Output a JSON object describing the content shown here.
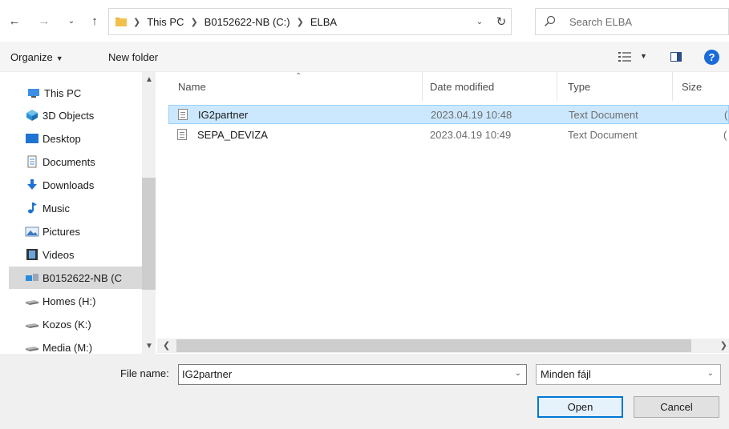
{
  "address": {
    "crumbs": [
      "This PC",
      "B0152622-NB (C:)",
      "ELBA"
    ]
  },
  "search": {
    "placeholder": "Search ELBA"
  },
  "toolbar": {
    "organize_label": "Organize",
    "new_folder_label": "New folder"
  },
  "navpane": {
    "items": [
      {
        "label": "This PC",
        "icon": "computer-icon"
      },
      {
        "label": "3D Objects",
        "icon": "cube-icon"
      },
      {
        "label": "Desktop",
        "icon": "desktop-icon"
      },
      {
        "label": "Documents",
        "icon": "document-icon"
      },
      {
        "label": "Downloads",
        "icon": "download-arrow-icon"
      },
      {
        "label": "Music",
        "icon": "music-note-icon"
      },
      {
        "label": "Pictures",
        "icon": "picture-icon"
      },
      {
        "label": "Videos",
        "icon": "film-icon"
      },
      {
        "label": "B0152622-NB (C",
        "icon": "local-drive-icon"
      },
      {
        "label": "Homes (H:)",
        "icon": "network-drive-icon"
      },
      {
        "label": "Kozos (K:)",
        "icon": "network-drive-icon"
      },
      {
        "label": "Media (M:)",
        "icon": "network-drive-icon"
      }
    ]
  },
  "filelist": {
    "columns": [
      "Name",
      "Date modified",
      "Type",
      "Size"
    ],
    "rows": [
      {
        "name": "IG2partner",
        "date": "2023.04.19 10:48",
        "type": "Text Document",
        "size": "("
      },
      {
        "name": "SEPA_DEVIZA",
        "date": "2023.04.19 10:49",
        "type": "Text Document",
        "size": "("
      }
    ]
  },
  "bottom": {
    "file_name_label": "File name:",
    "file_name_value": "IG2partner",
    "file_type_value": "Minden fájl",
    "open_label": "Open",
    "cancel_label": "Cancel"
  },
  "colors": {
    "accent": "#0078d7",
    "selection_fill": "#cce8ff",
    "selection_border": "#99d1ff",
    "help_blue": "#1a6bd8"
  }
}
